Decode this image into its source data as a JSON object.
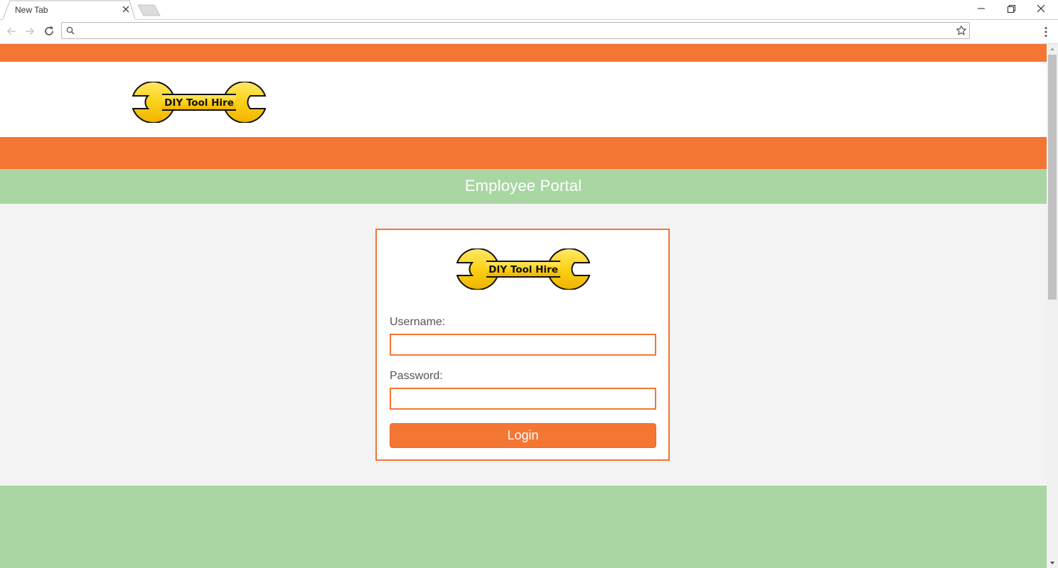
{
  "browser": {
    "tab_title": "New Tab",
    "address_value": "",
    "address_placeholder": ""
  },
  "site": {
    "logo_text": "DIY Tool Hire",
    "page_heading": "Employee Portal",
    "colors": {
      "orange": "#f47633",
      "green": "#a9d6a3",
      "page_bg": "#f3f3f3",
      "logo_yellow": "#fcd116"
    }
  },
  "login": {
    "username_label": "Username:",
    "username_value": "",
    "password_label": "Password:",
    "password_value": "",
    "submit_label": "Login"
  }
}
